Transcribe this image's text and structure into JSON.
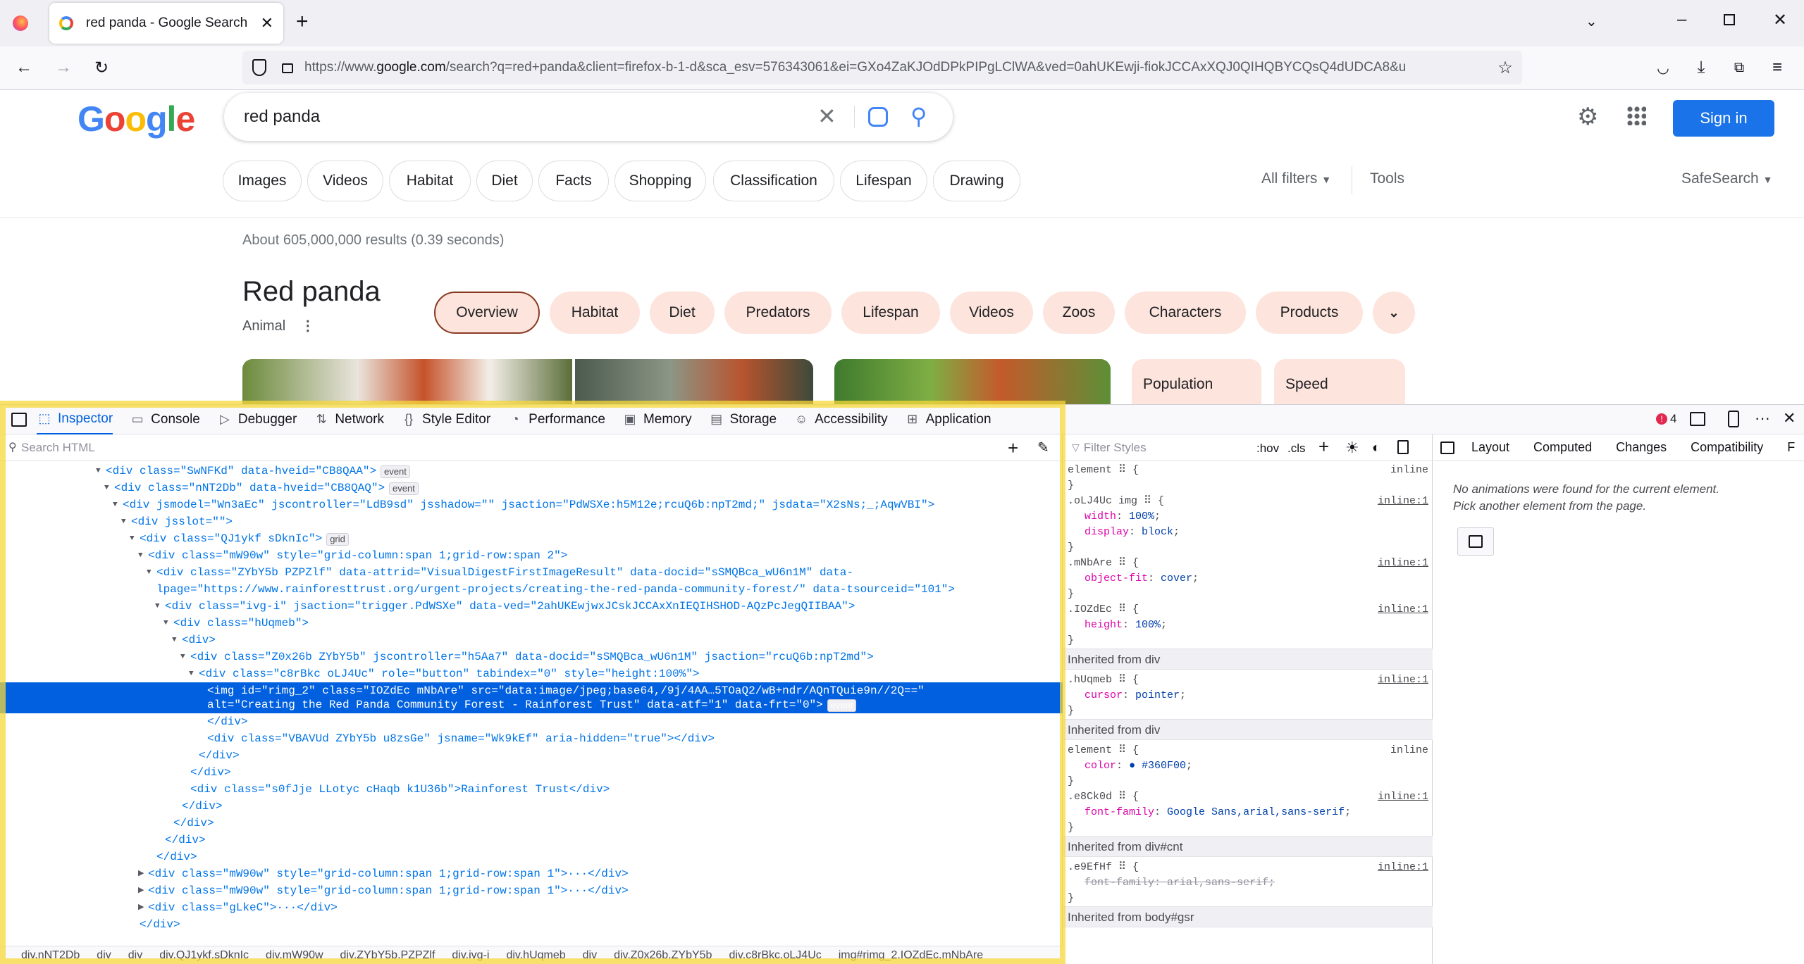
{
  "browser": {
    "tab_title": "red panda - Google Search",
    "url_prefix": "https://www.",
    "url_domain": "google.com",
    "url_rest": "/search?q=red+panda&client=firefox-b-1-d&sca_esv=576343061&ei=GXo4ZaKJOdDPkPIPgLClWA&ved=0ahUKEwji-fiokJCCAxXQJ0QIHQBYCQsQ4dUDCA8&u",
    "new_tab": "+"
  },
  "google": {
    "logo": "Google",
    "query": "red panda",
    "sign_in": "Sign in",
    "chips": [
      "Images",
      "Videos",
      "Habitat",
      "Diet",
      "Facts",
      "Shopping",
      "Classification",
      "Lifespan",
      "Drawing"
    ],
    "all_filters": "All filters",
    "tools": "Tools",
    "safesearch": "SafeSearch",
    "results_count": "About 605,000,000 results (0.39 seconds)",
    "kp_title": "Red panda",
    "kp_subtitle": "Animal",
    "kp_tabs": [
      "Overview",
      "Habitat",
      "Diet",
      "Predators",
      "Lifespan",
      "Videos",
      "Zoos",
      "Characters",
      "Products"
    ],
    "kp_cards": [
      "Population",
      "Speed"
    ]
  },
  "devtools": {
    "tabs": [
      "Inspector",
      "Console",
      "Debugger",
      "Network",
      "Style Editor",
      "Performance",
      "Memory",
      "Storage",
      "Accessibility",
      "Application"
    ],
    "search_placeholder": "Search HTML",
    "filter_placeholder": "Filter Styles",
    "hov": ":hov",
    "cls": ".cls",
    "error_count": "4",
    "side_tabs": [
      "Layout",
      "Computed",
      "Changes",
      "Compatibility",
      "F"
    ],
    "animations_msg1": "No animations were found for the current element.",
    "animations_msg2": "Pick another element from the page.",
    "breadcrumb": [
      "div.nNT2Db",
      "div",
      "div",
      "div.QJ1ykf.sDknIc",
      "div.mW90w",
      "div.ZYbY5b.PZPZlf",
      "div.ivg-i",
      "div.hUqmeb",
      "div",
      "div.Z0x26b.ZYbY5b",
      "div.c8rBkc.oLJ4Uc",
      "img#rimg_2.IOZdEc.mNbAre"
    ],
    "markup": [
      {
        "t": "<div class=\"SwNFKd\" data-hveid=\"CB8QAA\">",
        "b": "event",
        "i": 150,
        "tw": "▼"
      },
      {
        "t": "<div class=\"nNT2Db\" data-hveid=\"CB8QAQ\">",
        "b": "event",
        "i": 162,
        "tw": "▼"
      },
      {
        "t": "<div jsmodel=\"Wn3aEc\" jscontroller=\"LdB9sd\" jsshadow=\"\" jsaction=\"PdWSXe:h5M12e;rcuQ6b:npT2md;\" jsdata=\"X2sNs;_;AqwVBI\">",
        "b": "",
        "i": 174,
        "tw": "▼"
      },
      {
        "t": "<div jsslot=\"\">",
        "b": "",
        "i": 186,
        "tw": "▼"
      },
      {
        "t": "<div class=\"QJ1ykf sDknIc\">",
        "b": "grid",
        "i": 198,
        "tw": "▼"
      },
      {
        "t": "<div class=\"mW90w\" style=\"grid-column:span 1;grid-row:span 2\">",
        "b": "",
        "i": 210,
        "tw": "▼"
      },
      {
        "t": "<div class=\"ZYbY5b PZPZlf\" data-attrid=\"VisualDigestFirstImageResult\" data-docid=\"sSMQBca_wU6n1M\" data-",
        "b": "",
        "i": 222,
        "tw": "▼"
      },
      {
        "t": "lpage=\"https://www.rainforesttrust.org/urgent-projects/creating-the-red-panda-community-forest/\" data-tsourceid=\"101\">",
        "b": "",
        "i": 222,
        "tw": ""
      },
      {
        "t": "<div class=\"ivg-i\" jsaction=\"trigger.PdWSXe\" data-ved=\"2ahUKEwjwxJCskJCCAxXnIEQIHSHOD-AQzPcJegQIIBAA\">",
        "b": "",
        "i": 234,
        "tw": "▼"
      },
      {
        "t": "<div class=\"hUqmeb\">",
        "b": "",
        "i": 246,
        "tw": "▼"
      },
      {
        "t": "<div>",
        "b": "",
        "i": 258,
        "tw": "▼"
      },
      {
        "t": "<div class=\"Z0x26b ZYbY5b\" jscontroller=\"h5Aa7\" data-docid=\"sSMQBca_wU6n1M\" jsaction=\"rcuQ6b:npT2md\">",
        "b": "",
        "i": 270,
        "tw": "▼"
      },
      {
        "t": "<div class=\"c8rBkc oLJ4Uc\" role=\"button\" tabindex=\"0\" style=\"height:100%\">",
        "b": "",
        "i": 282,
        "tw": "▼"
      },
      {
        "t": "<img id=\"rimg_2\" class=\"IOZdEc mNbAre\" src=\"data:image/jpeg;base64,/9j/4AA…5TOaQ2/wB+ndr/AQnTQuie9n//2Q==\"",
        "t2": "alt=\"Creating the Red Panda Community Forest - Rainforest Trust\" data-atf=\"1\" data-frt=\"0\">",
        "b": "event",
        "i": 294,
        "tw": "",
        "sel": true
      },
      {
        "t": "</div>",
        "b": "",
        "i": 294,
        "tw": ""
      },
      {
        "t": "<div class=\"VBAVUd ZYbY5b u8zsGe\" jsname=\"Wk9kEf\" aria-hidden=\"true\"></div>",
        "b": "",
        "i": 294,
        "tw": ""
      },
      {
        "t": "</div>",
        "b": "",
        "i": 282,
        "tw": ""
      },
      {
        "t": "</div>",
        "b": "",
        "i": 270,
        "tw": ""
      },
      {
        "t": "<div class=\"s0fJje LLotyc cHaqb k1U36b\">Rainforest Trust</div>",
        "b": "",
        "i": 270,
        "tw": ""
      },
      {
        "t": "</div>",
        "b": "",
        "i": 258,
        "tw": ""
      },
      {
        "t": "</div>",
        "b": "",
        "i": 246,
        "tw": ""
      },
      {
        "t": "</div>",
        "b": "",
        "i": 234,
        "tw": ""
      },
      {
        "t": "</div>",
        "b": "",
        "i": 222,
        "tw": ""
      },
      {
        "t": "<div class=\"mW90w\" style=\"grid-column:span 1;grid-row:span 1\">···</div>",
        "b": "",
        "i": 210,
        "tw": "▶"
      },
      {
        "t": "<div class=\"mW90w\" style=\"grid-column:span 1;grid-row:span 1\">···</div>",
        "b": "",
        "i": 210,
        "tw": "▶"
      },
      {
        "t": "<div class=\"gLkeC\">···</div>",
        "b": "",
        "i": 210,
        "tw": "▶"
      },
      {
        "t": "</div>",
        "b": "",
        "i": 198,
        "tw": ""
      }
    ],
    "rules": [
      {
        "k": "sel",
        "t": "element ⠿ {",
        "src": "inline"
      },
      {
        "k": "end",
        "t": "}"
      },
      {
        "k": "sel",
        "t": ".oLJ4Uc img ⠿ {",
        "src": "inline:1"
      },
      {
        "k": "prop",
        "p": "width",
        "v": "100%"
      },
      {
        "k": "prop",
        "p": "display",
        "v": "block"
      },
      {
        "k": "end",
        "t": "}"
      },
      {
        "k": "sel",
        "t": ".mNbAre ⠿ {",
        "src": "inline:1"
      },
      {
        "k": "prop",
        "p": "object-fit",
        "v": "cover"
      },
      {
        "k": "end",
        "t": "}"
      },
      {
        "k": "sel",
        "t": ".IOZdEc ⠿ {",
        "src": "inline:1"
      },
      {
        "k": "prop",
        "p": "height",
        "v": "100%"
      },
      {
        "k": "end",
        "t": "}"
      },
      {
        "k": "hdr",
        "t": "Inherited from div"
      },
      {
        "k": "sel",
        "t": ".hUqmeb ⠿ {",
        "src": "inline:1"
      },
      {
        "k": "prop",
        "p": "cursor",
        "v": "pointer"
      },
      {
        "k": "end",
        "t": "}"
      },
      {
        "k": "hdr",
        "t": "Inherited from div"
      },
      {
        "k": "sel",
        "t": "element ⠿ {",
        "src": "inline"
      },
      {
        "k": "prop",
        "p": "color",
        "v": "● #360F00"
      },
      {
        "k": "end",
        "t": "}"
      },
      {
        "k": "sel",
        "t": ".e8Ck0d ⠿ {",
        "src": "inline:1"
      },
      {
        "k": "prop",
        "p": "font-family",
        "v": "Google Sans,arial,sans-serif"
      },
      {
        "k": "end",
        "t": "}"
      },
      {
        "k": "hdr",
        "t": "Inherited from div#cnt"
      },
      {
        "k": "sel",
        "t": ".e9EfHf ⠿ {",
        "src": "inline:1"
      },
      {
        "k": "prop",
        "p": "font-family",
        "v": "arial,sans-serif",
        "strike": true
      },
      {
        "k": "end",
        "t": "}"
      },
      {
        "k": "hdr",
        "t": "Inherited from body#gsr"
      }
    ]
  },
  "colors": {
    "google_blue": "#1a73e8",
    "chip_peach": "#fde4dc",
    "selection": "#0060df",
    "overlay_yellow": "#f5d83a"
  }
}
